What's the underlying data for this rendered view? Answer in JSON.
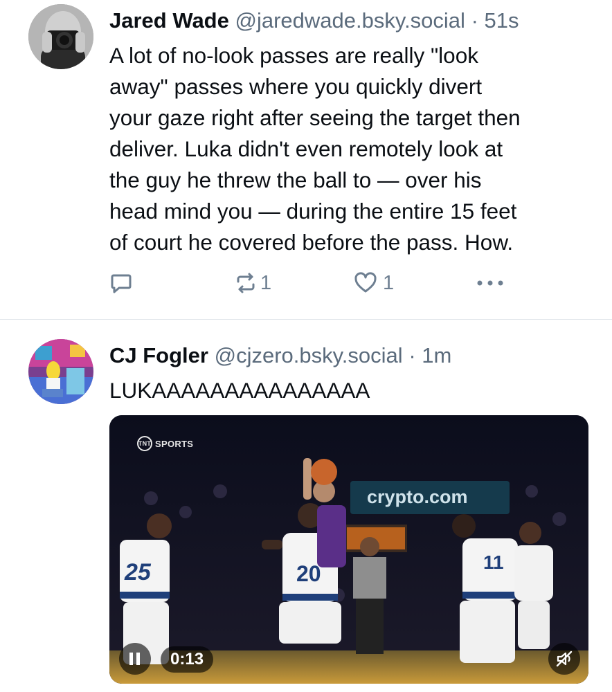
{
  "post1": {
    "avatar_icon": "photographer-avatar",
    "author_name": "Jared Wade",
    "handle": "@jaredwade.bsky.social",
    "separator": "·",
    "time": "51s",
    "text_lines": [
      "A lot of no-look passes are really \"look",
      "away\" passes where you quickly divert",
      "your gaze right after seeing the target then",
      "deliver. Luka didn't even remotely look at",
      "the guy he threw the ball to — over his",
      "head mind you — during the entire 15 feet",
      "of court he covered before the pass. How."
    ],
    "actions": {
      "reply_icon": "reply-icon",
      "repost_icon": "repost-icon",
      "repost_count": "1",
      "like_icon": "heart-icon",
      "like_count": "1",
      "more_icon": "more-icon"
    }
  },
  "post2": {
    "avatar_icon": "cartoon-avatar",
    "author_name": "CJ Fogler",
    "handle": "@cjzero.bsky.social",
    "separator": "·",
    "time": "1m",
    "text": "LUKAAAAAAAAAAAAAAA",
    "video": {
      "broadcaster": "SPORTS",
      "broadcaster_badge": "TNT",
      "arena_sign": "crypto.com",
      "jersey_numbers": [
        "25",
        "20",
        "11"
      ],
      "time": "0:13",
      "pause_icon": "pause-icon",
      "mute_icon": "muted-speaker-icon"
    }
  },
  "colors": {
    "text": "#0b0f14",
    "muted": "#5b6b7c",
    "icon": "#6e7f91",
    "divider": "#dfe4ea"
  }
}
